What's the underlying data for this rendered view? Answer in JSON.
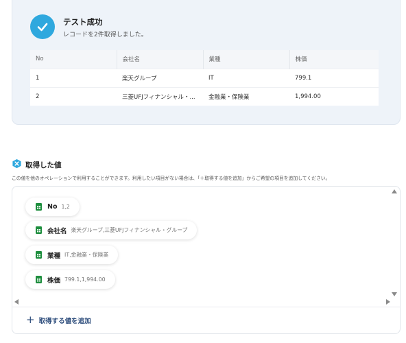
{
  "success": {
    "title": "テスト成功",
    "subtitle": "レコードを2件取得しました。",
    "accent_color": "#2fa8de"
  },
  "table": {
    "headers": [
      "No",
      "会社名",
      "業種",
      "株価"
    ],
    "rows": [
      [
        "1",
        "楽天グループ",
        "IT",
        "799.1"
      ],
      [
        "2",
        "三菱UFJフィナンシャル・...",
        "金融業・保険業",
        "1,994.00"
      ]
    ]
  },
  "retrieved": {
    "title": "取得した値",
    "description": "この値を他のオペレーションで利用することができます。利用したい項目がない場合は、「＋取得する値を追加」からご希望の項目を追加してください。",
    "chips": [
      {
        "label": "No",
        "value": "1,2"
      },
      {
        "label": "会社名",
        "value": "楽天グループ,三菱UFJフィナンシャル・グループ"
      },
      {
        "label": "業種",
        "value": "IT,金融業・保険業"
      },
      {
        "label": "株価",
        "value": "799.1,1,994.00"
      }
    ],
    "add_label": "取得する値を追加",
    "icon_color": "#2fa8de",
    "sheet_icon_color": "#1e8e3e"
  }
}
